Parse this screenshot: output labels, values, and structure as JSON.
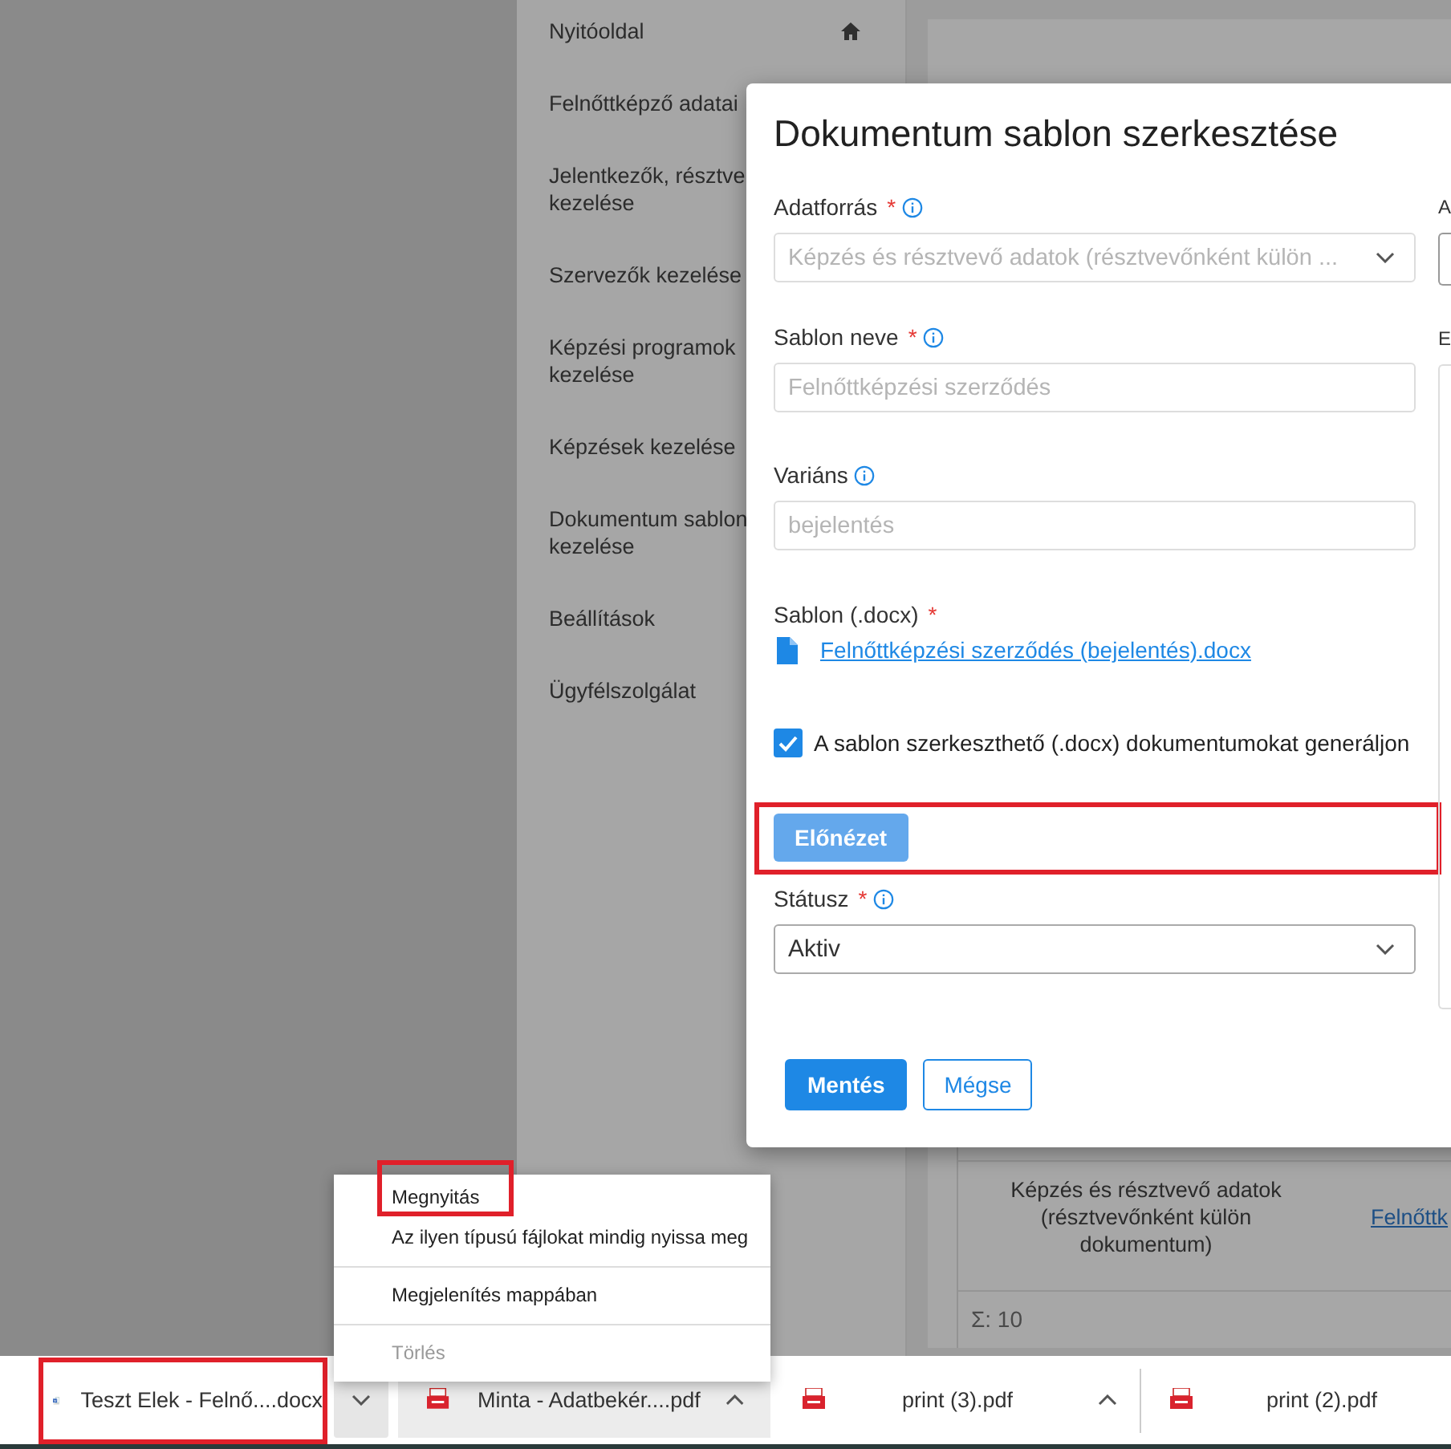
{
  "sidebar": {
    "items": [
      {
        "kind": "home",
        "label": "Nyitóoldal"
      },
      {
        "kind": "plain",
        "label": "Felnőttképző adatai"
      },
      {
        "kind": "plain",
        "label": "Jelentkezők, résztve\nkezelése"
      },
      {
        "kind": "plain",
        "label": "Szervezők kezelése"
      },
      {
        "kind": "plain",
        "label": "Képzési programok\nkezelése"
      },
      {
        "kind": "plain",
        "label": "Képzések kezelése"
      },
      {
        "kind": "plain",
        "label": "Dokumentum sablon\nkezelése"
      },
      {
        "kind": "plain",
        "label": "Beállítások"
      },
      {
        "kind": "plain",
        "label": "Ügyfélszolgálat"
      }
    ]
  },
  "background_table": {
    "rows": [
      {
        "cells": [
          {
            "kind": "text",
            "text": "Képzés és résztvevő adatok\n(résztvevőnként külön\ndokumentum)"
          },
          {
            "kind": "link",
            "text": "Felnőttk"
          }
        ]
      }
    ],
    "footer": "Σ: 10"
  },
  "dialog": {
    "title": "Dokumentum sablon szerkesztése",
    "fields": [
      {
        "kind": "select",
        "label": "Adatforrás",
        "required_mark": "*",
        "info": true,
        "placeholder": "Képzés és résztvevő adatok (résztvevőnként külön ..."
      },
      {
        "kind": "text",
        "label": "Sablon neve",
        "required_mark": "*",
        "info": true,
        "placeholder": "Felnőttképzési szerződés"
      },
      {
        "kind": "text",
        "label": "Variáns",
        "info": true,
        "placeholder": "bejelentés"
      },
      {
        "kind": "file",
        "label": "Sablon (.docx)",
        "required_mark": "*",
        "info": false,
        "link": "Felnőttképzési szerződés (bejelentés).docx"
      },
      {
        "kind": "checkbox",
        "label": "A sablon szerkeszthető (.docx) dokumentumokat generáljon",
        "checked": true
      },
      {
        "kind": "button",
        "label": "Előnézet",
        "highlighted": true
      },
      {
        "kind": "select",
        "label": "Státusz",
        "required_mark": "*",
        "info": true,
        "value": "Aktiv"
      }
    ],
    "right_column": [
      {
        "kind": "input",
        "label": "A"
      },
      {
        "kind": "textarea",
        "label": "E"
      }
    ],
    "buttons": [
      {
        "kind": "primary",
        "label": "Mentés"
      },
      {
        "kind": "secondary",
        "label": "Mégse"
      }
    ]
  },
  "context_menu": {
    "groups": [
      {
        "items": [
          {
            "label": "Megnyitás",
            "highlighted": true,
            "disabled": false
          },
          {
            "label": "Az ilyen típusú fájlokat mindig nyissa meg",
            "highlighted": false,
            "disabled": false
          }
        ]
      },
      {
        "items": [
          {
            "label": "Megjelenítés mappában",
            "highlighted": false,
            "disabled": false
          }
        ]
      },
      {
        "items": [
          {
            "label": "Törlés",
            "highlighted": false,
            "disabled": true
          }
        ]
      }
    ]
  },
  "downloads": [
    {
      "name": "Teszt Elek - Felnő....docx",
      "kind": "word",
      "highlighted": true,
      "hovered": false,
      "caret": true,
      "menu_open": true
    },
    {
      "name": "Minta - Adatbekér....pdf",
      "kind": "pdf",
      "highlighted": false,
      "hovered": true,
      "caret": true,
      "menu_open": false
    },
    {
      "name": "print (3).pdf",
      "kind": "pdf",
      "highlighted": false,
      "hovered": false,
      "caret": true,
      "menu_open": false
    },
    {
      "name": "print (2).pdf",
      "kind": "pdf",
      "highlighted": false,
      "hovered": false,
      "caret": false,
      "menu_open": false
    }
  ]
}
